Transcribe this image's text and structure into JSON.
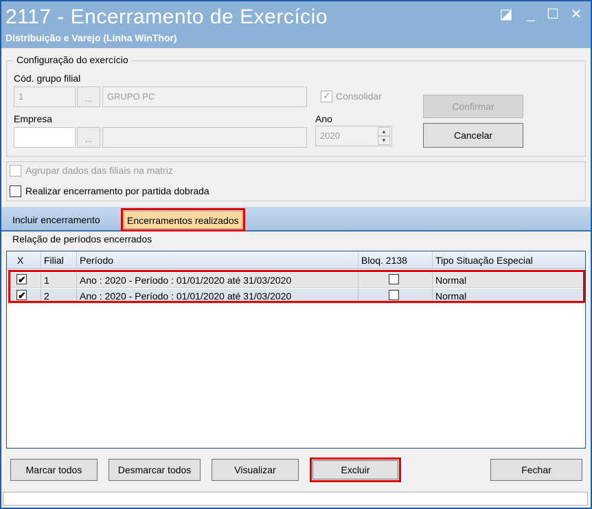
{
  "window": {
    "title": "2117 - Encerramento de Exercício",
    "subtitle": "Distribuição e Varejo (Linha WinThor)",
    "controls": [
      "◪",
      "_",
      "☐",
      "✕"
    ]
  },
  "config": {
    "group_title": "Configuração do exercício",
    "cod_grupo_label": "Cód. grupo filial",
    "cod_grupo_value": "1",
    "ellipsis": "...",
    "grupo_name_value": "GRUPO PC",
    "consolidar_label": "Consolidar",
    "empresa_label": "Empresa",
    "empresa_value": "",
    "empresa_name_value": "",
    "ano_label": "Ano",
    "ano_value": "2020",
    "confirmar_label": "Confirmar",
    "cancelar_label": "Cancelar"
  },
  "options": {
    "agrupar_label": "Agrupar dados das filiais na matriz",
    "partida_dobrada_label": "Realizar encerramento por partida dobrada"
  },
  "tabs": [
    {
      "label": "Incluir encerramento"
    },
    {
      "label": "Encerramentos realizados"
    }
  ],
  "list": {
    "title": "Relação de períodos encerrados",
    "columns": [
      "X",
      "Filial",
      "Período",
      "Bloq. 2138",
      "Tipo Situação Especial"
    ],
    "rows": [
      {
        "checked": true,
        "filial": "1",
        "periodo": "Ano : 2020 - Período : 01/01/2020 até 31/03/2020",
        "bloq": false,
        "tipo": "Normal"
      },
      {
        "checked": true,
        "filial": "2",
        "periodo": "Ano : 2020 - Período : 01/01/2020 até 31/03/2020",
        "bloq": false,
        "tipo": "Normal"
      }
    ]
  },
  "footer": {
    "marcar_todos": "Marcar todos",
    "desmarcar_todos": "Desmarcar todos",
    "visualizar": "Visualizar",
    "excluir": "Excluir",
    "fechar": "Fechar"
  },
  "colors": {
    "title_bar": "#8cb2d8",
    "highlight": "#e00000",
    "active_tab": "#f9d9a0"
  }
}
